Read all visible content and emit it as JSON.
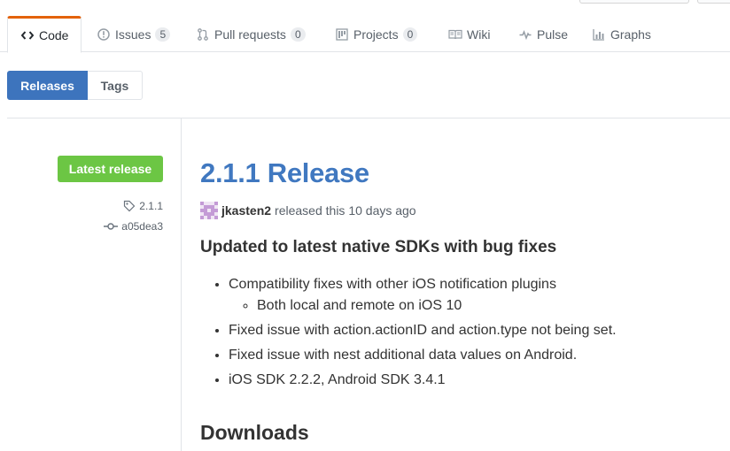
{
  "repo_nav": {
    "tabs": [
      {
        "label": "Code",
        "icon": "code-icon",
        "selected": true
      },
      {
        "label": "Issues",
        "icon": "issue-opened-icon",
        "count": "5"
      },
      {
        "label": "Pull requests",
        "icon": "git-pull-request-icon",
        "count": "0"
      },
      {
        "label": "Projects",
        "icon": "project-icon",
        "count": "0"
      },
      {
        "label": "Wiki",
        "icon": "book-icon"
      },
      {
        "label": "Pulse",
        "icon": "pulse-icon"
      },
      {
        "label": "Graphs",
        "icon": "graph-icon"
      }
    ]
  },
  "subnav": {
    "releases_label": "Releases",
    "tags_label": "Tags"
  },
  "release": {
    "latest_label": "Latest release",
    "tag": "2.1.1",
    "commit": "a05dea3",
    "title": "2.1.1 Release",
    "author": "jkasten2",
    "released_text": "released this 10 days ago",
    "heading": "Updated to latest native SDKs with bug fixes",
    "notes": [
      "Compatibility fixes with other iOS notification plugins",
      "Both local and remote on iOS 10",
      "Fixed issue with action.actionID and action.type not being set.",
      "Fixed issue with nest additional data values on Android.",
      "iOS SDK 2.2.2, Android SDK 3.4.1"
    ],
    "downloads_heading": "Downloads"
  },
  "colors": {
    "accent_blue": "#4078c0",
    "selected_subnav": "#3d74bd",
    "latest_green": "#6cc644",
    "tab_underline": "#e36209"
  }
}
